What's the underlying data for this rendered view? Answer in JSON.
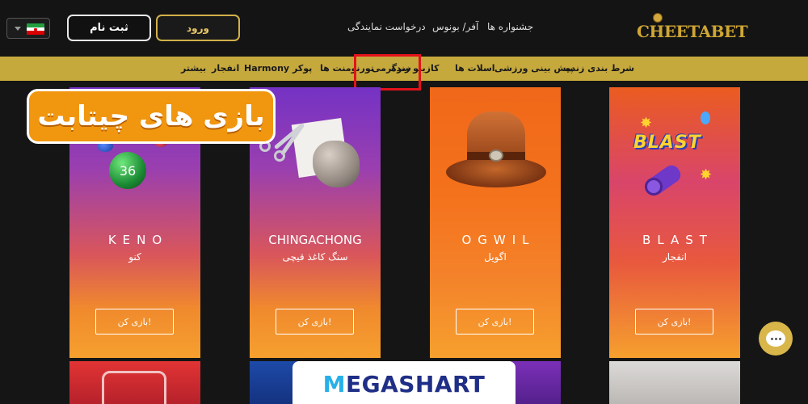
{
  "header": {
    "register_label": "ثبت نام",
    "login_label": "ورود",
    "top_links": [
      "جشنواره ها",
      "آفر/ بونوس",
      "درخواست نمایندگی"
    ],
    "logo_text": "CHEETABET"
  },
  "navbar": {
    "items": [
      "شرط بندی زنده",
      "پیش بینی ورزشی",
      "اسلات ها",
      "کازینو زنده",
      "سرگرمی",
      "تورنومنت ها",
      "پوکر",
      "Harmony",
      "انفجار",
      "بیشتر"
    ],
    "highlighted": "سرگرمی"
  },
  "overlay_title": "بازی های چیتابت",
  "games": [
    {
      "name": "KENO",
      "subname": "کنو",
      "play_label": "بازی کن!"
    },
    {
      "name": "CHINGACHONG",
      "subname": "سنگ کاغذ قیچی",
      "play_label": "بازی کن!"
    },
    {
      "name": "OGWIL",
      "subname": "اگویل",
      "play_label": "بازی کن!"
    },
    {
      "name": "BLAST",
      "subname": "انفجار",
      "play_label": "بازی کن!"
    }
  ],
  "keno_ball_number": "36",
  "blast_logo_text": "BLAST",
  "watermark": {
    "mark": "M",
    "text": "EGASHART"
  },
  "colors": {
    "gold": "#c6a93d",
    "highlight": "#e3121b",
    "background": "#151515",
    "overlay_orange": "#f1960f"
  },
  "icons": [
    "flag-iran-icon",
    "chevron-down-icon",
    "chat-icon"
  ]
}
